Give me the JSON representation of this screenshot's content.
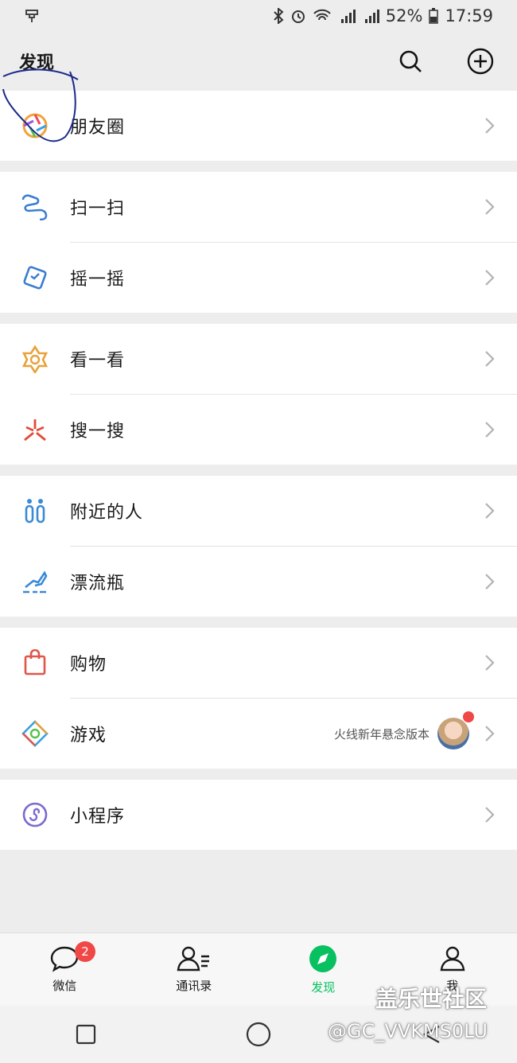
{
  "status": {
    "battery": "52%",
    "time": "17:59"
  },
  "header": {
    "title": "发现"
  },
  "groups": [
    [
      {
        "label": "朋友圈",
        "icon": "moments-icon"
      }
    ],
    [
      {
        "label": "扫一扫",
        "icon": "scan-icon"
      },
      {
        "label": "摇一摇",
        "icon": "shake-icon"
      }
    ],
    [
      {
        "label": "看一看",
        "icon": "top-stories-icon"
      },
      {
        "label": "搜一搜",
        "icon": "search-search-icon"
      }
    ],
    [
      {
        "label": "附近的人",
        "icon": "people-nearby-icon"
      },
      {
        "label": "漂流瓶",
        "icon": "drift-bottle-icon"
      }
    ],
    [
      {
        "label": "购物",
        "icon": "shopping-bag-icon"
      },
      {
        "label": "游戏",
        "icon": "games-icon",
        "extra": "火线新年悬念版本"
      }
    ],
    [
      {
        "label": "小程序",
        "icon": "mini-programs-icon"
      }
    ]
  ],
  "tabbar": {
    "chats": {
      "label": "微信",
      "badge": "2"
    },
    "contacts": {
      "label": "通讯录"
    },
    "discover": {
      "label": "发现"
    },
    "me": {
      "label": "我"
    }
  },
  "watermark": {
    "line1": "盖乐世社区",
    "line2": "@GC_VVKMS0LU"
  },
  "colors": {
    "accent": "#07c160",
    "badge": "#f04747"
  }
}
